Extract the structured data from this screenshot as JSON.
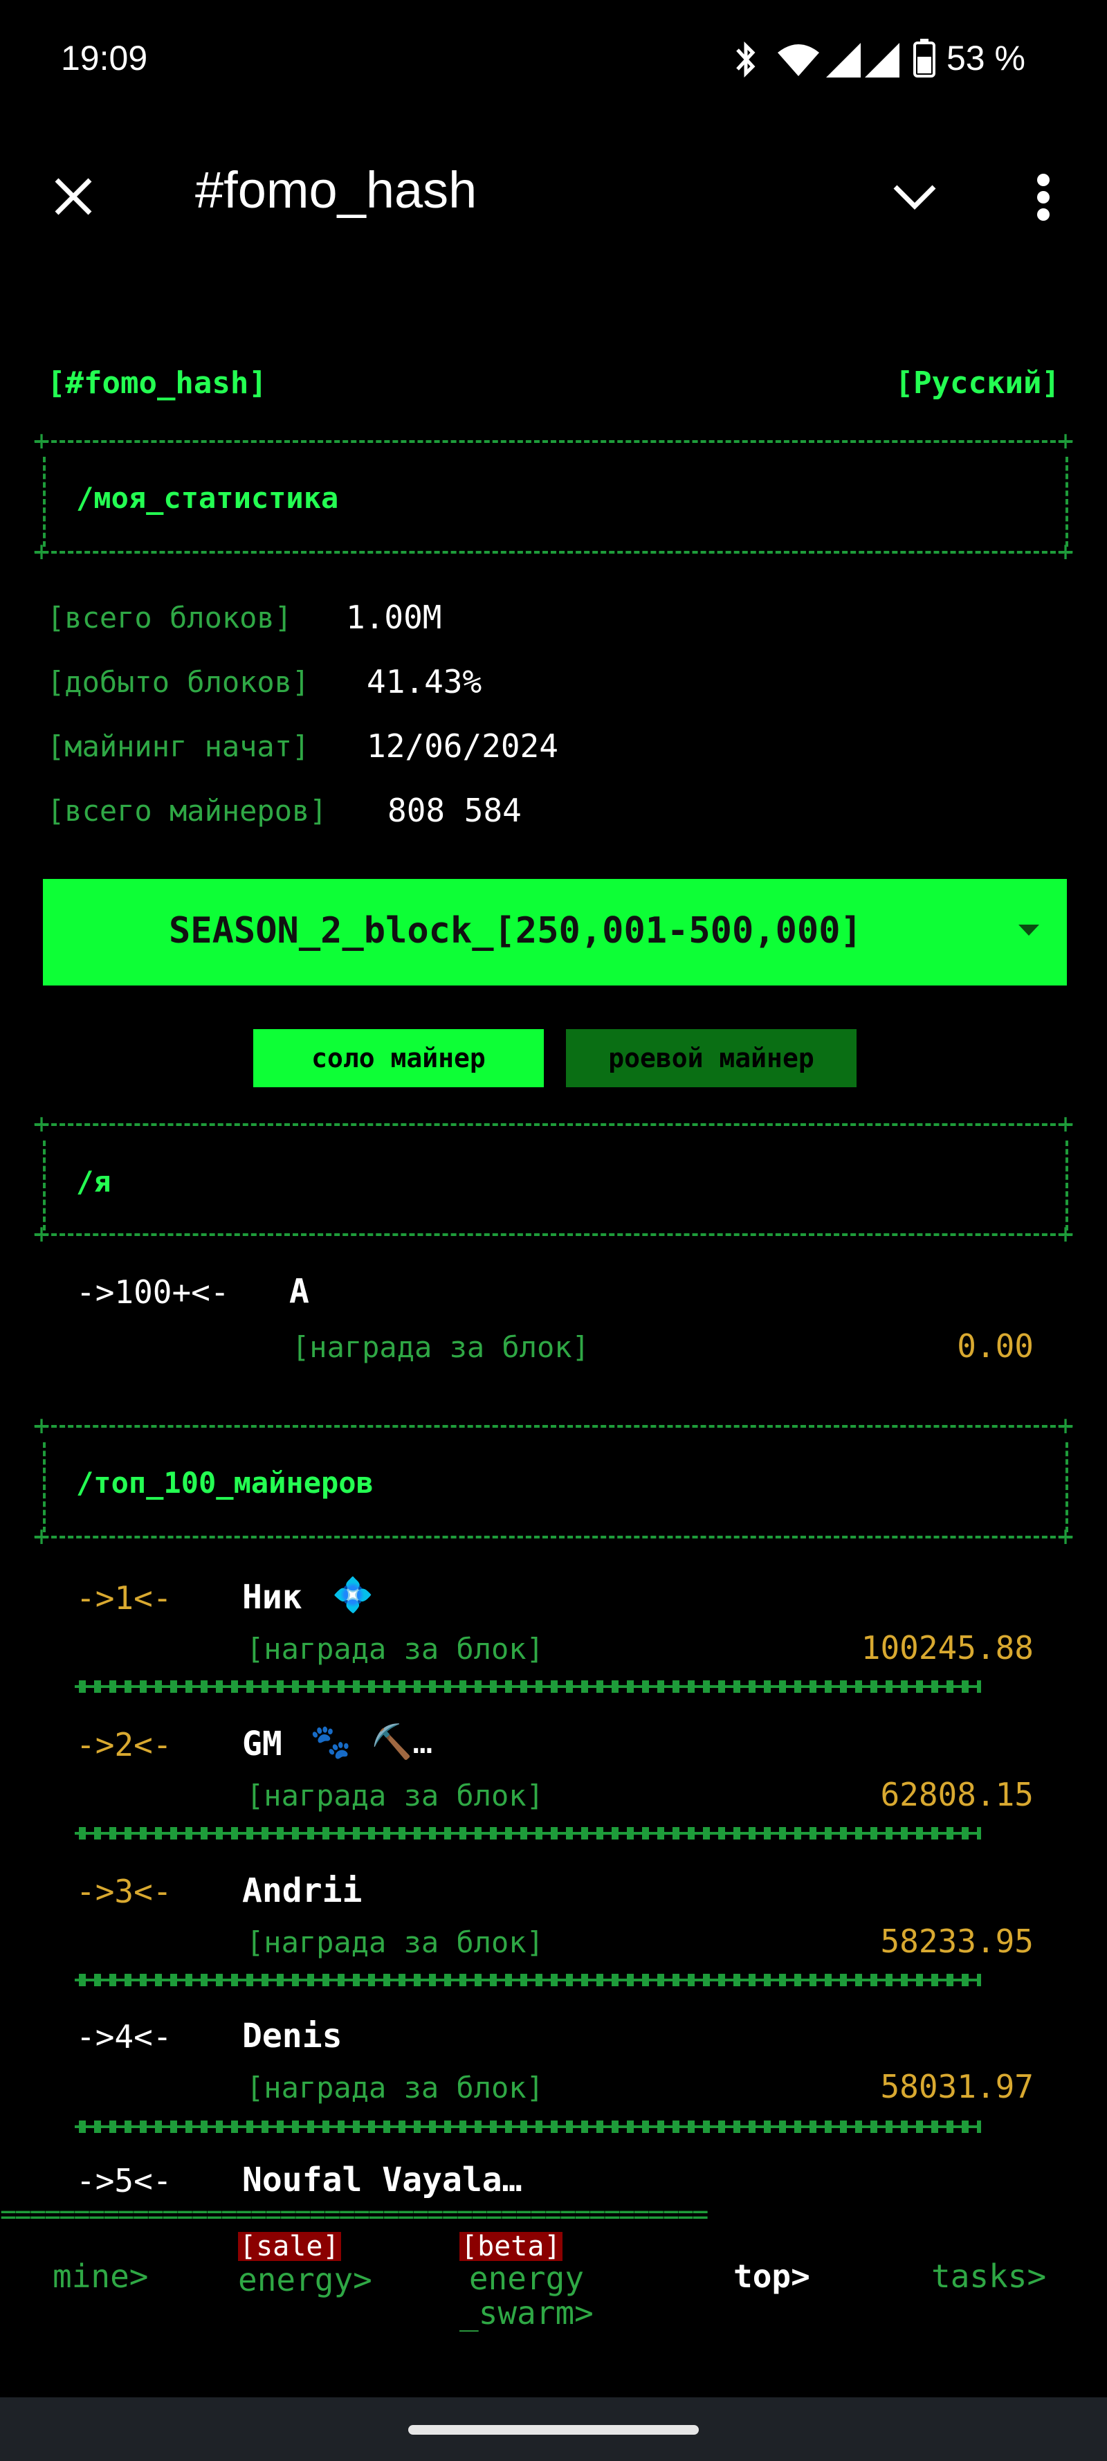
{
  "status_bar": {
    "time": "19:09",
    "battery": "53 %"
  },
  "app_bar": {
    "title": "#fomo_hash"
  },
  "header": {
    "channel": "[#fomo_hash]",
    "language": "[Русский]"
  },
  "my_stats": {
    "title": "/моя_статистика",
    "rows": [
      {
        "label": "[всего блоков]",
        "value": "1.00M"
      },
      {
        "label": "[добыто блоков]",
        "value": "41.43%"
      },
      {
        "label": "[майнинг начат]",
        "value": "12/06/2024"
      },
      {
        "label": "[всего майнеров]",
        "value": "808 584"
      }
    ]
  },
  "season_select": {
    "value": "SEASON_2_block_[250,001-500,000]"
  },
  "toggle": {
    "solo": "соло майнер",
    "swarm": "роевой майнер"
  },
  "me": {
    "title": "/я",
    "rank": "->100+<-",
    "name": "A",
    "reward_label": "[награда за блок]",
    "reward": "0.00"
  },
  "top": {
    "title": "/топ_100_майнеров",
    "miners": [
      {
        "rank": "->1<-",
        "name": "Ник",
        "emoji": "💠",
        "reward_label": "[награда за блок]",
        "reward": "100245.88"
      },
      {
        "rank": "->2<-",
        "name": "GM",
        "emoji": "🐾 ⛏️…",
        "reward_label": "[награда за блок]",
        "reward": "62808.15"
      },
      {
        "rank": "->3<-",
        "name": "Andrіі",
        "emoji": "",
        "reward_label": "[награда за блок]",
        "reward": "58233.95"
      },
      {
        "rank": "->4<-",
        "name": "Denis",
        "emoji": "",
        "reward_label": "[награда за блок]",
        "reward": "58031.97"
      },
      {
        "rank": "->5<-",
        "name": "Noufal Vayala…",
        "emoji": "",
        "reward_label": "",
        "reward": ""
      }
    ]
  },
  "bottom_nav": {
    "separator": "================================================",
    "items": [
      {
        "label": "mine>",
        "badge": ""
      },
      {
        "label": "energy>",
        "badge": "[sale]"
      },
      {
        "label": "energy\n_swarm>",
        "badge": "[beta]"
      },
      {
        "label": "top>",
        "badge": ""
      },
      {
        "label": "tasks>",
        "badge": ""
      }
    ]
  },
  "colors": {
    "accent": "#24ff52",
    "dim": "#2fa845",
    "gold": "#d9a930",
    "badge": "#8b0000",
    "dark_green": "#0a6f14"
  }
}
